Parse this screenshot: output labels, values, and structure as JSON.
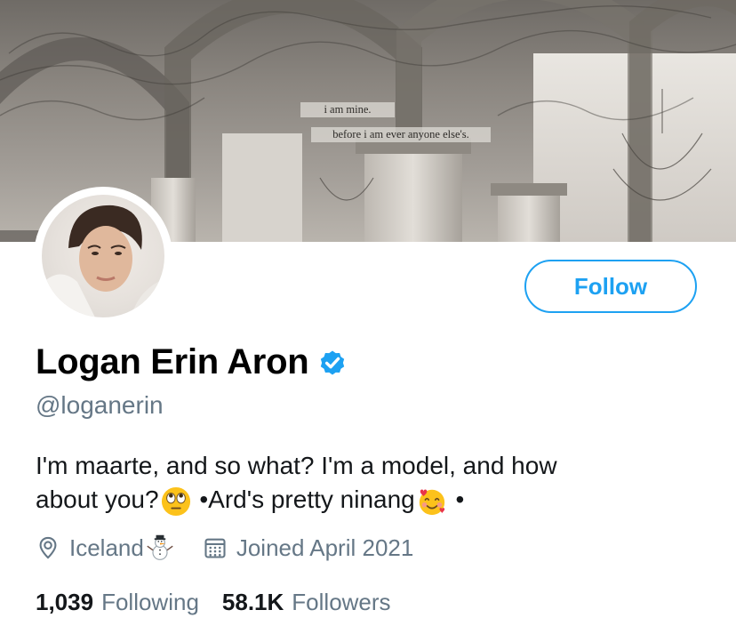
{
  "banner": {
    "quote_line1": "i am mine.",
    "quote_line2": "before i am ever anyone else's."
  },
  "profile": {
    "name": "Logan Erin Aron",
    "verified": true,
    "handle": "@loganerin",
    "bio_line1": "I'm maarte, and so what? I'm a model, and how",
    "bio_line2_a": "about you?",
    "bio_line2_emoji1": "face-with-rolling-eyes",
    "bio_line2_b": " •Ard's pretty ninang",
    "bio_line2_emoji2": "smiling-face-with-hearts",
    "bio_line2_c": " •",
    "location": "Iceland",
    "location_emoji": "snowman",
    "joined": "Joined April 2021"
  },
  "actions": {
    "follow_label": "Follow"
  },
  "stats": {
    "following_count": "1,039",
    "following_label": "Following",
    "followers_count": "58.1K",
    "followers_label": "Followers"
  },
  "colors": {
    "accent": "#1da1f2",
    "secondary_text": "#657786",
    "primary_text": "#14171a"
  }
}
